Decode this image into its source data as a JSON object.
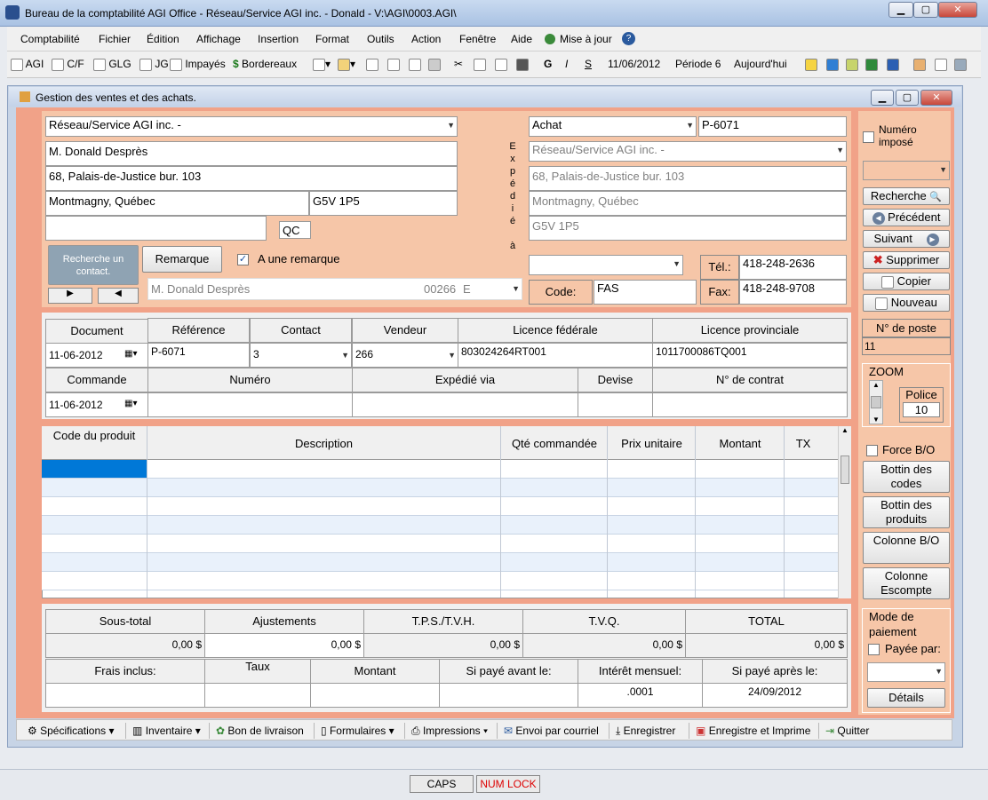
{
  "window": {
    "title": "Bureau de la comptabilité AGI Office - Réseau/Service AGI inc. - Donald - V:\\AGI\\0003.AGI\\",
    "min": "▁",
    "max": "▢",
    "close": "✕"
  },
  "menu": [
    "Comptabilité",
    "Fichier",
    "Édition",
    "Affichage",
    "Insertion",
    "Format",
    "Outils",
    "Action",
    "Fenêtre",
    "Aide",
    "Mise à jour"
  ],
  "toolbar": {
    "agi": "AGI",
    "cf": "C/F",
    "glg": "GLG",
    "jg": "JG",
    "impayes": "Impayés",
    "bordereaux": "Bordereaux",
    "bold": "G",
    "italic": "I",
    "underline": "S",
    "date": "11/06/2012",
    "periode": "Période 6",
    "today": "Aujourd'hui"
  },
  "child": {
    "title": "Gestion des ventes et des achats."
  },
  "client": {
    "company": "Réseau/Service AGI inc.  -",
    "contact": "M. Donald Desprès",
    "address": "68, Palais-de-Justice bur. 103",
    "city": "Montmagny, Québec",
    "postal": "G5V 1P5",
    "province": "QC"
  },
  "contact_search": "Recherche un contact.",
  "remarque": {
    "button": "Remarque",
    "checkbox": "A une remarque",
    "checked": true
  },
  "contact_line": {
    "name": "M. Donald Desprès",
    "code": "00266",
    "e": "E"
  },
  "ship_label": [
    "E",
    "x",
    "p",
    "é",
    "d",
    "i",
    "é",
    "",
    "à"
  ],
  "ship": {
    "type": "Achat",
    "number": "P-6071",
    "company": "Réseau/Service AGI inc.  -",
    "address": "68, Palais-de-Justice bur. 103",
    "city": "Montmagny, Québec",
    "postal": "G5V 1P5"
  },
  "phone": {
    "tel_label": "Tél.:",
    "tel": "418-248-2636",
    "fax_label": "Fax:",
    "fax": "418-248-9708",
    "code_label": "Code:",
    "code": "FAS"
  },
  "right": {
    "numero_impose": "Numéro imposé",
    "recherche": "Recherche",
    "precedent": "Précédent",
    "suivant": "Suivant",
    "supprimer": "Supprimer",
    "copier": "Copier",
    "nouveau": "Nouveau",
    "poste_label": "N° de poste",
    "poste": "11",
    "zoom": "ZOOM",
    "police": "Police",
    "police_val": "10",
    "force_bo": "Force B/O",
    "bottin_codes": "Bottin des codes",
    "bottin_produits": "Bottin des produits",
    "colonne_bo": "Colonne B/O",
    "colonne_escompte": "Colonne Escompte",
    "mode_paiement": "Mode de paiement",
    "payee_par": "Payée par:",
    "details": "Détails"
  },
  "doc": {
    "h_document": "Document",
    "h_reference": "Référence",
    "h_contact": "Contact",
    "h_vendeur": "Vendeur",
    "h_lic_fed": "Licence fédérale",
    "h_lic_prov": "Licence provinciale",
    "document": "11-06-2012",
    "reference": "P-6071",
    "contact": "3",
    "vendeur": "266",
    "lic_fed": "803024264RT001",
    "lic_prov": "1011700086TQ001",
    "h_commande": "Commande",
    "h_numero": "Numéro",
    "h_expedie": "Expédié via",
    "h_devise": "Devise",
    "h_contrat": "N° de contrat",
    "commande": "11-06-2012"
  },
  "lines": {
    "h_code": "Code du produit",
    "h_desc": "Description",
    "h_qte": "Qté commandée",
    "h_prix": "Prix unitaire",
    "h_montant": "Montant",
    "h_tx": "TX"
  },
  "totals": {
    "h_sous": "Sous-total",
    "h_ajust": "Ajustements",
    "h_tps": "T.P.S./T.V.H.",
    "h_tvq": "T.V.Q.",
    "h_total": "TOTAL",
    "sous": "0,00 $",
    "ajust": "0,00 $",
    "tps": "0,00 $",
    "tvq": "0,00 $",
    "total": "0,00 $",
    "h_frais": "Frais inclus:",
    "h_taux": "Taux",
    "h_montant": "Montant",
    "h_avant": "Si payé avant le:",
    "h_interet": "Intérêt mensuel:",
    "h_apres": "Si payé après le:",
    "interet": ".0001",
    "apres": "24/09/2012"
  },
  "bottom": {
    "specs": "Spécifications",
    "inventaire": "Inventaire",
    "bon": "Bon de livraison",
    "formulaires": "Formulaires",
    "impressions": "Impressions",
    "envoi": "Envoi par courriel",
    "enregistrer": "Enregistrer",
    "enreg_imprime": "Enregistre et Imprime",
    "quitter": "Quitter"
  },
  "status": {
    "caps": "CAPS",
    "num": "NUM LOCK"
  },
  "colors": {
    "salmon": "#f6c6a8",
    "frame": "#f1a288",
    "selected": "#0078d7"
  }
}
